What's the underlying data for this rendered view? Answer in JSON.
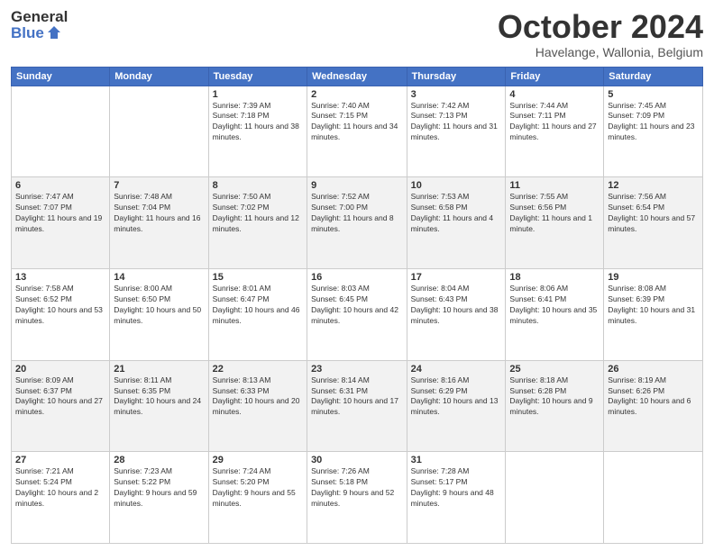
{
  "header": {
    "logo_general": "General",
    "logo_blue": "Blue",
    "month_title": "October 2024",
    "subtitle": "Havelange, Wallonia, Belgium"
  },
  "days_of_week": [
    "Sunday",
    "Monday",
    "Tuesday",
    "Wednesday",
    "Thursday",
    "Friday",
    "Saturday"
  ],
  "weeks": [
    [
      {
        "day": "",
        "sunrise": "",
        "sunset": "",
        "daylight": ""
      },
      {
        "day": "",
        "sunrise": "",
        "sunset": "",
        "daylight": ""
      },
      {
        "day": "1",
        "sunrise": "Sunrise: 7:39 AM",
        "sunset": "Sunset: 7:18 PM",
        "daylight": "Daylight: 11 hours and 38 minutes."
      },
      {
        "day": "2",
        "sunrise": "Sunrise: 7:40 AM",
        "sunset": "Sunset: 7:15 PM",
        "daylight": "Daylight: 11 hours and 34 minutes."
      },
      {
        "day": "3",
        "sunrise": "Sunrise: 7:42 AM",
        "sunset": "Sunset: 7:13 PM",
        "daylight": "Daylight: 11 hours and 31 minutes."
      },
      {
        "day": "4",
        "sunrise": "Sunrise: 7:44 AM",
        "sunset": "Sunset: 7:11 PM",
        "daylight": "Daylight: 11 hours and 27 minutes."
      },
      {
        "day": "5",
        "sunrise": "Sunrise: 7:45 AM",
        "sunset": "Sunset: 7:09 PM",
        "daylight": "Daylight: 11 hours and 23 minutes."
      }
    ],
    [
      {
        "day": "6",
        "sunrise": "Sunrise: 7:47 AM",
        "sunset": "Sunset: 7:07 PM",
        "daylight": "Daylight: 11 hours and 19 minutes."
      },
      {
        "day": "7",
        "sunrise": "Sunrise: 7:48 AM",
        "sunset": "Sunset: 7:04 PM",
        "daylight": "Daylight: 11 hours and 16 minutes."
      },
      {
        "day": "8",
        "sunrise": "Sunrise: 7:50 AM",
        "sunset": "Sunset: 7:02 PM",
        "daylight": "Daylight: 11 hours and 12 minutes."
      },
      {
        "day": "9",
        "sunrise": "Sunrise: 7:52 AM",
        "sunset": "Sunset: 7:00 PM",
        "daylight": "Daylight: 11 hours and 8 minutes."
      },
      {
        "day": "10",
        "sunrise": "Sunrise: 7:53 AM",
        "sunset": "Sunset: 6:58 PM",
        "daylight": "Daylight: 11 hours and 4 minutes."
      },
      {
        "day": "11",
        "sunrise": "Sunrise: 7:55 AM",
        "sunset": "Sunset: 6:56 PM",
        "daylight": "Daylight: 11 hours and 1 minute."
      },
      {
        "day": "12",
        "sunrise": "Sunrise: 7:56 AM",
        "sunset": "Sunset: 6:54 PM",
        "daylight": "Daylight: 10 hours and 57 minutes."
      }
    ],
    [
      {
        "day": "13",
        "sunrise": "Sunrise: 7:58 AM",
        "sunset": "Sunset: 6:52 PM",
        "daylight": "Daylight: 10 hours and 53 minutes."
      },
      {
        "day": "14",
        "sunrise": "Sunrise: 8:00 AM",
        "sunset": "Sunset: 6:50 PM",
        "daylight": "Daylight: 10 hours and 50 minutes."
      },
      {
        "day": "15",
        "sunrise": "Sunrise: 8:01 AM",
        "sunset": "Sunset: 6:47 PM",
        "daylight": "Daylight: 10 hours and 46 minutes."
      },
      {
        "day": "16",
        "sunrise": "Sunrise: 8:03 AM",
        "sunset": "Sunset: 6:45 PM",
        "daylight": "Daylight: 10 hours and 42 minutes."
      },
      {
        "day": "17",
        "sunrise": "Sunrise: 8:04 AM",
        "sunset": "Sunset: 6:43 PM",
        "daylight": "Daylight: 10 hours and 38 minutes."
      },
      {
        "day": "18",
        "sunrise": "Sunrise: 8:06 AM",
        "sunset": "Sunset: 6:41 PM",
        "daylight": "Daylight: 10 hours and 35 minutes."
      },
      {
        "day": "19",
        "sunrise": "Sunrise: 8:08 AM",
        "sunset": "Sunset: 6:39 PM",
        "daylight": "Daylight: 10 hours and 31 minutes."
      }
    ],
    [
      {
        "day": "20",
        "sunrise": "Sunrise: 8:09 AM",
        "sunset": "Sunset: 6:37 PM",
        "daylight": "Daylight: 10 hours and 27 minutes."
      },
      {
        "day": "21",
        "sunrise": "Sunrise: 8:11 AM",
        "sunset": "Sunset: 6:35 PM",
        "daylight": "Daylight: 10 hours and 24 minutes."
      },
      {
        "day": "22",
        "sunrise": "Sunrise: 8:13 AM",
        "sunset": "Sunset: 6:33 PM",
        "daylight": "Daylight: 10 hours and 20 minutes."
      },
      {
        "day": "23",
        "sunrise": "Sunrise: 8:14 AM",
        "sunset": "Sunset: 6:31 PM",
        "daylight": "Daylight: 10 hours and 17 minutes."
      },
      {
        "day": "24",
        "sunrise": "Sunrise: 8:16 AM",
        "sunset": "Sunset: 6:29 PM",
        "daylight": "Daylight: 10 hours and 13 minutes."
      },
      {
        "day": "25",
        "sunrise": "Sunrise: 8:18 AM",
        "sunset": "Sunset: 6:28 PM",
        "daylight": "Daylight: 10 hours and 9 minutes."
      },
      {
        "day": "26",
        "sunrise": "Sunrise: 8:19 AM",
        "sunset": "Sunset: 6:26 PM",
        "daylight": "Daylight: 10 hours and 6 minutes."
      }
    ],
    [
      {
        "day": "27",
        "sunrise": "Sunrise: 7:21 AM",
        "sunset": "Sunset: 5:24 PM",
        "daylight": "Daylight: 10 hours and 2 minutes."
      },
      {
        "day": "28",
        "sunrise": "Sunrise: 7:23 AM",
        "sunset": "Sunset: 5:22 PM",
        "daylight": "Daylight: 9 hours and 59 minutes."
      },
      {
        "day": "29",
        "sunrise": "Sunrise: 7:24 AM",
        "sunset": "Sunset: 5:20 PM",
        "daylight": "Daylight: 9 hours and 55 minutes."
      },
      {
        "day": "30",
        "sunrise": "Sunrise: 7:26 AM",
        "sunset": "Sunset: 5:18 PM",
        "daylight": "Daylight: 9 hours and 52 minutes."
      },
      {
        "day": "31",
        "sunrise": "Sunrise: 7:28 AM",
        "sunset": "Sunset: 5:17 PM",
        "daylight": "Daylight: 9 hours and 48 minutes."
      },
      {
        "day": "",
        "sunrise": "",
        "sunset": "",
        "daylight": ""
      },
      {
        "day": "",
        "sunrise": "",
        "sunset": "",
        "daylight": ""
      }
    ]
  ]
}
